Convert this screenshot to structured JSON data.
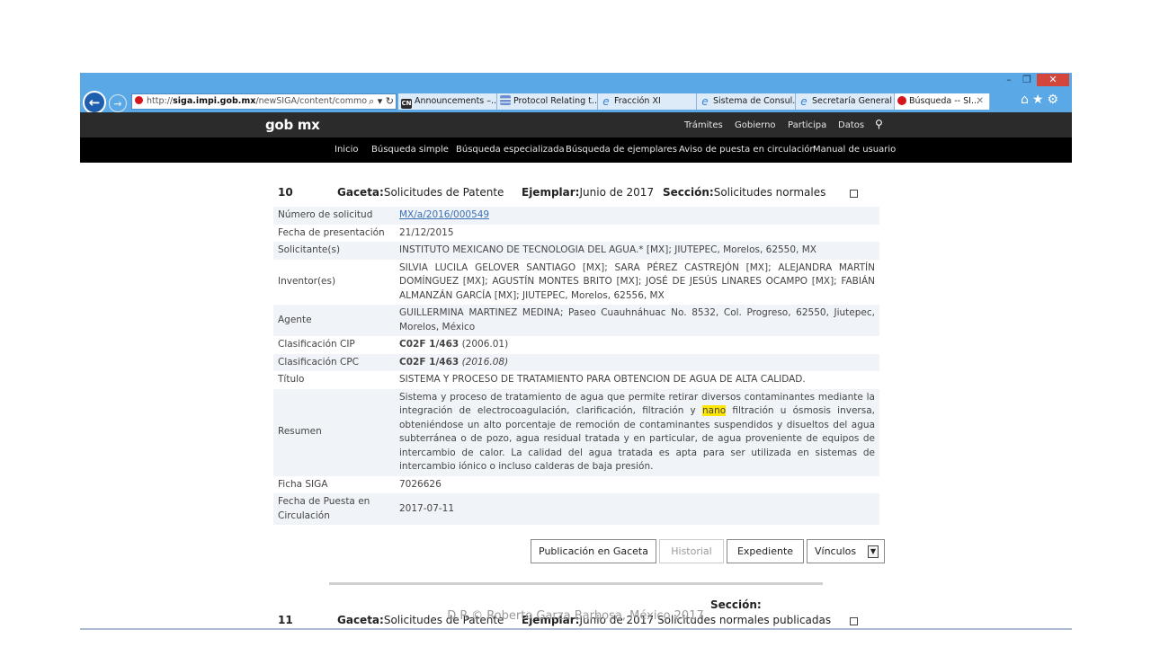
{
  "browser": {
    "address_host": "siga.impi.gob.mx",
    "address_prefix": "http://",
    "address_path": "/newSIGA/content/common/",
    "tabs": [
      {
        "label": "Announcements –...",
        "icon": "announcements-icon"
      },
      {
        "label": "Protocol Relating t...",
        "icon": "document-icon"
      },
      {
        "label": "Fracción XI",
        "icon": "ie-icon"
      },
      {
        "label": "Sistema de Consul...",
        "icon": "ie-icon"
      },
      {
        "label": "Secretaría General ...",
        "icon": "ie-icon"
      },
      {
        "label": "Búsqueda -- SI...",
        "icon": "red-dot-icon",
        "active": true
      }
    ]
  },
  "gob_header": {
    "logo": "gob mx",
    "nav": [
      "Trámites",
      "Gobierno",
      "Participa",
      "Datos"
    ]
  },
  "menu": [
    "Inicio",
    "Búsqueda simple",
    "Búsqueda especializada",
    "Búsqueda de ejemplares",
    "Aviso de puesta en circulación",
    "Manual de usuario"
  ],
  "record": {
    "number": "10",
    "gaceta_label": "Gaceta:",
    "gaceta_value": "Solicitudes de Patente",
    "ejemplar_label": "Ejemplar:",
    "ejemplar_value": "Junio de 2017",
    "seccion_label": "Sección:",
    "seccion_value": "Solicitudes normales",
    "fields": {
      "numero_label": "Número de solicitud",
      "numero_value": "MX/a/2016/000549",
      "fecha_label": "Fecha de presentación",
      "fecha_value": "21/12/2015",
      "solicitante_label": "Solicitante(s)",
      "solicitante_value": "INSTITUTO MEXICANO DE TECNOLOGIA DEL AGUA.* [MX]; JIUTEPEC, Morelos, 62550, MX",
      "inventor_label": "Inventor(es)",
      "inventor_value": "SILVIA LUCILA GELOVER SANTIAGO [MX]; SARA PÉREZ CASTREJÓN [MX]; ALEJANDRA MARTÍN DOMÍNGUEZ [MX]; AGUSTÍN MONTES BRITO [MX]; JOSÉ DE JESÚS LINARES OCAMPO [MX]; FABIÁN ALMANZÁN GARCÍA [MX]; JIUTEPEC, Morelos, 62556, MX",
      "agente_label": "Agente",
      "agente_value": "GUILLERMINA MARTINEZ MEDINA; Paseo Cuauhnáhuac No. 8532, Col. Progreso, 62550, Jiutepec, Morelos, México",
      "cip_label": "Clasificación CIP",
      "cip_code": "C02F 1/463",
      "cip_version": "(2006.01)",
      "cpc_label": "Clasificación CPC",
      "cpc_code": "C02F 1/463",
      "cpc_version": "(2016.08)",
      "titulo_label": "Título",
      "titulo_value": "SISTEMA Y PROCESO DE TRATAMIENTO PARA OBTENCION DE AGUA DE ALTA CALIDAD.",
      "resumen_label": "Resumen",
      "resumen_before": "Sistema y proceso de tratamiento de agua que permite retirar diversos contaminantes mediante la integración de electrocoagulación, clarificación, filtración y ",
      "resumen_highlight": "nano",
      "resumen_after": " filtración u ósmosis inversa, obteniéndose un alto porcentaje de remoción de contaminantes suspendidos y disueltos del agua subterránea o de pozo, agua residual tratada y en particular, de agua proveniente de equipos de intercambio de calor. La calidad del agua tratada es apta para ser utilizada en sistemas de intercambio iónico o incluso calderas de baja presión.",
      "ficha_label": "Ficha SIGA",
      "ficha_value": "7026626",
      "puesta_label": "Fecha de Puesta en Circulación",
      "puesta_value": "2017-07-11"
    },
    "buttons": {
      "publicacion": "Publicación en Gaceta",
      "historial": "Historial",
      "expediente": "Expediente",
      "vinculos": "Vínculos"
    }
  },
  "next_record": {
    "number": "11",
    "gaceta_label": "Gaceta:",
    "gaceta_value": "Solicitudes de Patente",
    "ejemplar_label": "Ejemplar:",
    "ejemplar_value": "Junio de 2017",
    "seccion_label": "Sección:",
    "seccion_value": "Solicitudes normales publicadas"
  },
  "credit": "D.R.© Roberto Garza Barbosa, México 2017"
}
